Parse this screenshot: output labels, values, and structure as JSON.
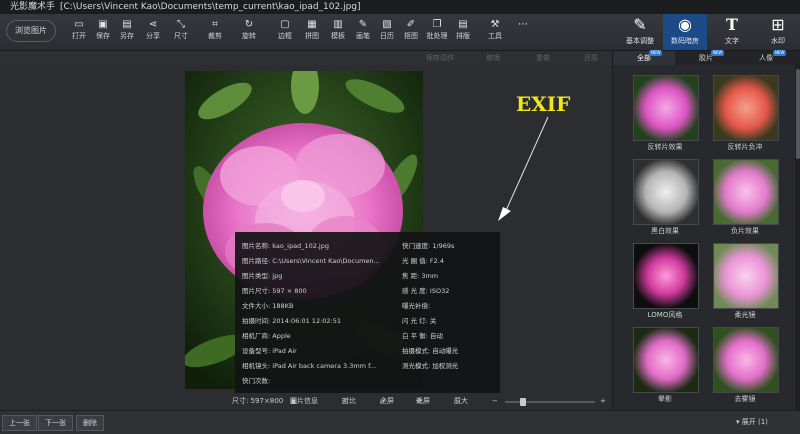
{
  "titlebar": {
    "app_name": "光影魔术手",
    "path": "[C:\\Users\\Vincent Kao\\Documents\\temp_current\\kao_ipad_102.jpg]"
  },
  "toolbar": {
    "browse": "浏览图片",
    "tools": [
      "打开",
      "保存",
      "另存",
      "分享",
      "尺寸",
      "裁剪",
      "旋转",
      "边框",
      "拼图",
      "模板",
      "画笔",
      "日历",
      "抠图",
      "批处理",
      "排版",
      "工具"
    ],
    "right_tabs": [
      "基本调整",
      "数码暗房",
      "文字",
      "水印"
    ]
  },
  "subbar": {
    "save_action": "保存动作",
    "undo": "撤销",
    "redo": "重做",
    "restore": "还原"
  },
  "annotation": {
    "text": "EXIF"
  },
  "exif": {
    "left": [
      {
        "label": "图片名称:",
        "value": "kao_ipad_102.jpg"
      },
      {
        "label": "图片路径:",
        "value": "C:\\Users\\Vincent Kao\\Documen..."
      },
      {
        "label": "图片类型:",
        "value": "jpg"
      },
      {
        "label": "图片尺寸:",
        "value": "597 × 800"
      },
      {
        "label": "文件大小:",
        "value": "188KB"
      },
      {
        "label": "拍摄时间:",
        "value": "2014:06:01 12:02:51"
      },
      {
        "label": "相机厂商:",
        "value": "Apple"
      },
      {
        "label": "设备型号:",
        "value": "iPad Air"
      },
      {
        "label": "相机镜头:",
        "value": "iPad Air back camera 3.3mm f..."
      },
      {
        "label": "快门次数:",
        "value": ""
      }
    ],
    "right": [
      {
        "label": "快门速度:",
        "value": "1/969s"
      },
      {
        "label": "光 圈 值:",
        "value": "F2.4"
      },
      {
        "label": "焦    距:",
        "value": "3mm"
      },
      {
        "label": "感 光 度:",
        "value": "ISO32"
      },
      {
        "label": "曝光补偿:",
        "value": ""
      },
      {
        "label": "闪 光 灯:",
        "value": "关"
      },
      {
        "label": "白 平 衡:",
        "value": "自动"
      },
      {
        "label": "拍摄模式:",
        "value": "自动曝光"
      },
      {
        "label": "测光模式:",
        "value": "加权测光"
      }
    ]
  },
  "statusbar": {
    "size": "尺寸: 597×800",
    "info": "图片信息",
    "compare": "对比",
    "fullscreen": "全屏",
    "fit": "适屏",
    "original": "原大",
    "minus": "−",
    "plus": "+"
  },
  "bottombar": {
    "prev": "上一张",
    "next": "下一张",
    "delete": "删除",
    "expand": "展开 (1)"
  },
  "rpanel": {
    "tabs": [
      "全部",
      "胶片",
      "人像"
    ],
    "new_badge": "NEW",
    "effects": [
      "反转片效果",
      "反转片负冲",
      "黑白效果",
      "负片效果",
      "LOMO风格",
      "柔光镜",
      "晕影",
      "去雾镜"
    ]
  },
  "colors": {
    "accent": "#1c4a86",
    "annotation": "#f3e51c",
    "bg": "#2b2d30"
  }
}
